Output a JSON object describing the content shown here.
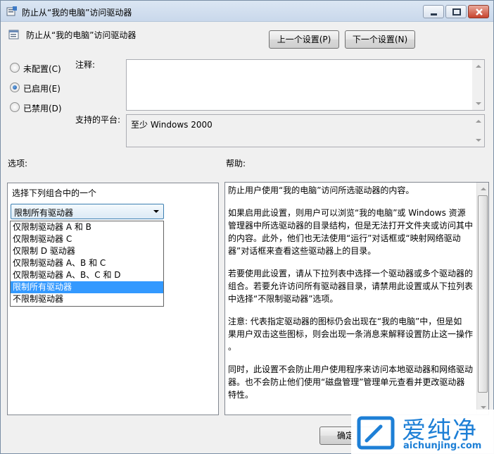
{
  "window": {
    "title": "防止从“我的电脑”访问驱动器"
  },
  "header": {
    "policy_title": "防止从“我的电脑”访问驱动器",
    "prev_button": "上一个设置(P)",
    "next_button": "下一个设置(N)"
  },
  "state": {
    "options": [
      {
        "label": "未配置(C)",
        "selected": false
      },
      {
        "label": "已启用(E)",
        "selected": true
      },
      {
        "label": "已禁用(D)",
        "selected": false
      }
    ]
  },
  "comment": {
    "label": "注释:",
    "value": ""
  },
  "platform": {
    "label": "支持的平台:",
    "value": "至少 Windows 2000"
  },
  "options_section": {
    "label": "选项:",
    "prompt": "选择下列组合中的一个",
    "selected_value": "限制所有驱动器",
    "list": [
      "仅限制驱动器 A 和 B",
      "仅限制驱动器 C",
      "仅限制 D 驱动器",
      "仅限制驱动器 A、B 和 C",
      "仅限制驱动器 A、B、C 和 D",
      "限制所有驱动器",
      "不限制驱动器"
    ],
    "highlighted_index": 5
  },
  "help_section": {
    "label": "帮助:",
    "lines": [
      "防止用户使用“我的电脑”访问所选驱动器的内容。",
      "",
      "如果启用此设置，则用户可以浏览“我的电脑”或 Windows 资源",
      "管理器中所选驱动器的目录结构，但是无法打开文件夹或访问其中",
      "的内容。此外，他们也无法使用“运行”对话框或“映射网络驱动",
      "器”对话框来查看这些驱动器上的目录。",
      "",
      "若要使用此设置，请从下拉列表中选择一个驱动器或多个驱动器的",
      "组合。若要允许访问所有驱动器目录，请禁用此设置或从下拉列表",
      "中选择“不限制驱动器”选项。",
      "",
      "注意: 代表指定驱动器的图标仍会出现在“我的电脑”中，但是如",
      "果用户双击这些图标，则会出现一条消息来解释设置防止这一操作",
      "。",
      "",
      "同时，此设置不会防止用户使用程序来访问本地驱动器和网络驱动",
      "器。也不会防止他们使用“磁盘管理”管理单元查看并更改驱动器",
      "特性。"
    ]
  },
  "footer": {
    "ok_button": "确定"
  },
  "watermark": {
    "name": "爱纯净",
    "url": "aichunjing.com"
  },
  "colors": {
    "selection": "#3399ff",
    "dialog_bg": "#f0f0f0",
    "watermark_blue": "#1d7fd6"
  }
}
